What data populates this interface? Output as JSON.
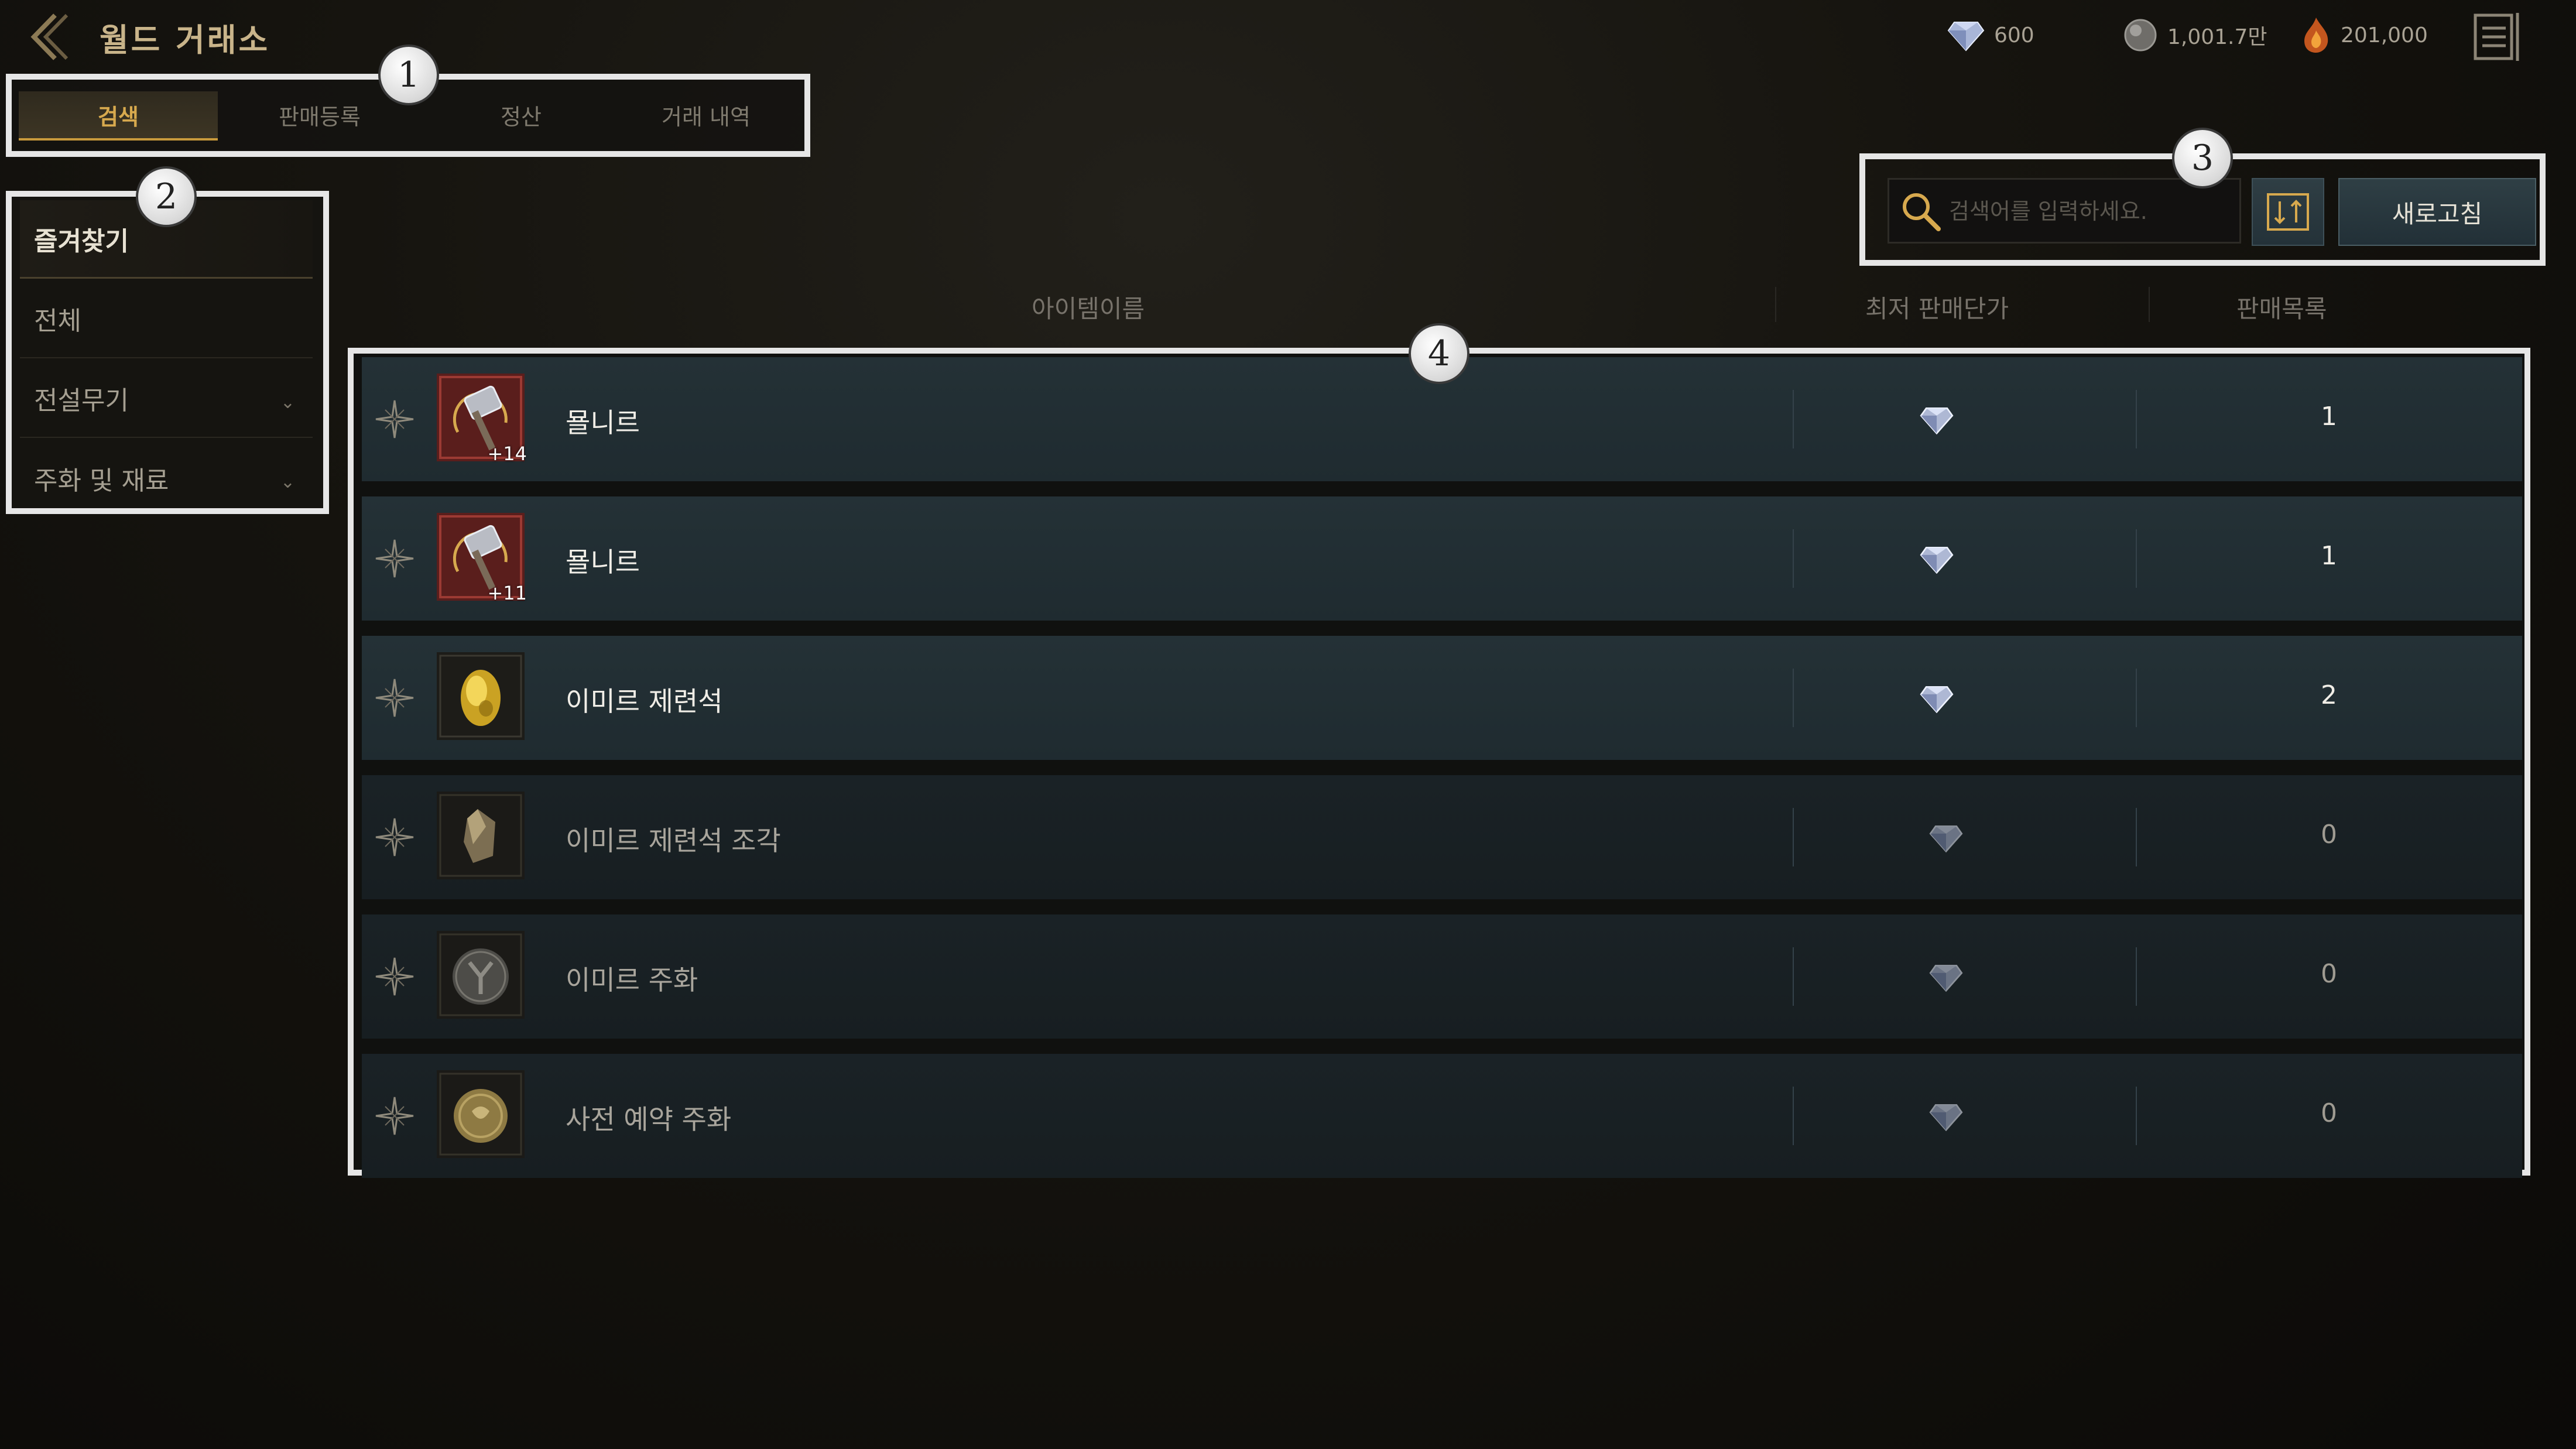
{
  "header": {
    "title": "월드 거래소",
    "currencies": [
      {
        "icon": "diamond-icon",
        "value": "600"
      },
      {
        "icon": "silver-orb-icon",
        "value": "1,001.7만"
      },
      {
        "icon": "fire-gem-icon",
        "value": "201,000"
      }
    ]
  },
  "tabs": [
    {
      "label": "검색",
      "active": true
    },
    {
      "label": "판매등록",
      "active": false
    },
    {
      "label": "정산",
      "active": false
    },
    {
      "label": "거래 내역",
      "active": false
    }
  ],
  "sidebar": {
    "items": [
      {
        "label": "즐겨찾기",
        "selected": true,
        "expandable": false
      },
      {
        "label": "전체",
        "selected": false,
        "expandable": false
      },
      {
        "label": "전설무기",
        "selected": false,
        "expandable": true
      },
      {
        "label": "주화 및 재료",
        "selected": false,
        "expandable": true
      }
    ]
  },
  "search": {
    "placeholder": "검색어를 입력하세요.",
    "refresh_label": "새로고침"
  },
  "columns": {
    "name": "아이템이름",
    "price": "최저 판매단가",
    "listings": "판매목록"
  },
  "items": [
    {
      "name": "묠니르",
      "enhance": "+14",
      "count": "1",
      "icon": "hammer-icon",
      "dim": false
    },
    {
      "name": "묠니르",
      "enhance": "+11",
      "count": "1",
      "icon": "hammer-icon",
      "dim": false
    },
    {
      "name": "이미르 제련석",
      "enhance": "",
      "count": "2",
      "icon": "gold-stone-icon",
      "dim": false
    },
    {
      "name": "이미르 제련석 조각",
      "enhance": "",
      "count": "0",
      "icon": "stone-fragment-icon",
      "dim": true
    },
    {
      "name": "이미르 주화",
      "enhance": "",
      "count": "0",
      "icon": "rune-coin-icon",
      "dim": true
    },
    {
      "name": "사전 예약 주화",
      "enhance": "",
      "count": "0",
      "icon": "gold-coin-icon",
      "dim": true
    }
  ],
  "markers": [
    "1",
    "2",
    "3",
    "4"
  ],
  "colors": {
    "accent_gold": "#d7a94e",
    "row_bg": "#243136",
    "highlight_border": "#e6e6e6"
  }
}
